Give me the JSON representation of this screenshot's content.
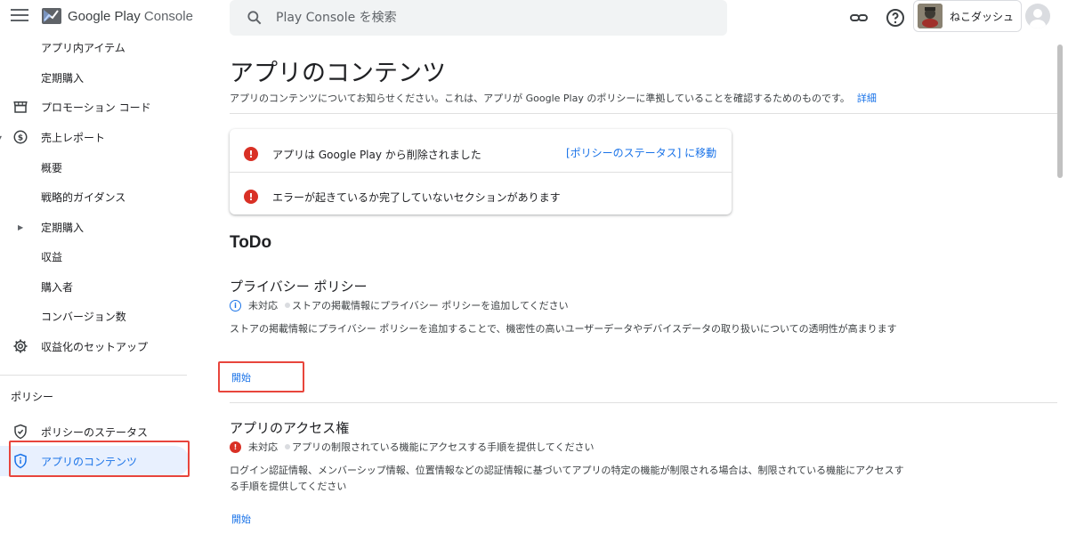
{
  "header": {
    "app_name_brand": "Google Play",
    "app_name_product": "Console",
    "search_placeholder": "Play Console を検索",
    "account_name": "ねこダッシュ"
  },
  "sidebar": {
    "items": [
      {
        "label": "アプリ内アイテム"
      },
      {
        "label": "定期購入"
      },
      {
        "label": "プロモーション コード",
        "icon": "store-icon"
      },
      {
        "label": "売上レポート",
        "icon": "dollar-icon"
      },
      {
        "label": "概要"
      },
      {
        "label": "戦略的ガイダンス"
      },
      {
        "label": "定期購入"
      },
      {
        "label": "収益"
      },
      {
        "label": "購入者"
      },
      {
        "label": "コンバージョン数"
      },
      {
        "label": "収益化のセットアップ",
        "icon": "gear-icon"
      }
    ],
    "policy_section_title": "ポリシー",
    "policy_items": [
      {
        "label": "ポリシーのステータス",
        "icon": "shield-check-icon"
      },
      {
        "label": "アプリのコンテンツ",
        "icon": "shield-info-icon",
        "active": true
      }
    ]
  },
  "main": {
    "title": "アプリのコンテンツ",
    "description": "アプリのコンテンツについてお知らせください。これは、アプリが Google Play のポリシーに準拠していることを確認するためのものです。",
    "description_link": "詳細",
    "alerts": [
      {
        "text": "アプリは Google Play から削除されました",
        "link": "[ポリシーのステータス] に移動"
      },
      {
        "text": "エラーが起きているか完了していないセクションがあります"
      }
    ],
    "todo_title": "ToDo",
    "sections": [
      {
        "title": "プライバシー ポリシー",
        "status": "未対応",
        "status_detail": "ストアの掲載情報にプライバシー ポリシーを追加してください",
        "body": "ストアの掲載情報にプライバシー ポリシーを追加することで、機密性の高いユーザーデータやデバイスデータの取り扱いについての透明性が高まります",
        "action": "開始"
      },
      {
        "title": "アプリのアクセス権",
        "status": "未対応",
        "status_detail": "アプリの制限されている機能にアクセスする手順を提供してください",
        "body": "ログイン認証情報、メンバーシップ情報、位置情報などの認証情報に基づいてアプリの特定の機能が制限される場合は、制限されている機能にアクセスする手順を提供してください",
        "action": "開始"
      }
    ]
  },
  "colors": {
    "accent": "#1a73e8",
    "error": "#d93025",
    "highlight": "#e8453c"
  }
}
